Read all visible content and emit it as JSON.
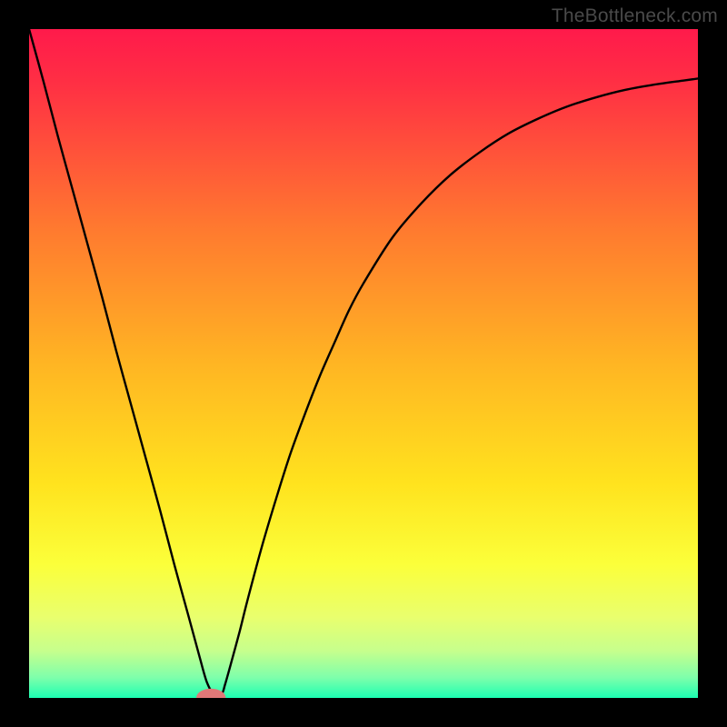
{
  "watermark": "TheBottleneck.com",
  "chart_data": {
    "type": "line",
    "title": "",
    "xlabel": "",
    "ylabel": "",
    "xlim": [
      0,
      100
    ],
    "ylim": [
      0,
      100
    ],
    "gradient_stops": [
      {
        "offset": 0.0,
        "color": "#ff1a4b"
      },
      {
        "offset": 0.08,
        "color": "#ff2f44"
      },
      {
        "offset": 0.3,
        "color": "#ff7a2f"
      },
      {
        "offset": 0.5,
        "color": "#ffb523"
      },
      {
        "offset": 0.68,
        "color": "#ffe31e"
      },
      {
        "offset": 0.8,
        "color": "#fbff3a"
      },
      {
        "offset": 0.88,
        "color": "#e9ff6e"
      },
      {
        "offset": 0.93,
        "color": "#c6ff8d"
      },
      {
        "offset": 0.97,
        "color": "#7dffab"
      },
      {
        "offset": 1.0,
        "color": "#1cffb2"
      }
    ],
    "series": [
      {
        "name": "curve",
        "x": [
          0.0,
          2.2,
          4.3,
          6.5,
          8.7,
          10.9,
          13.0,
          15.2,
          17.4,
          19.6,
          21.7,
          23.9,
          25.5,
          26.6,
          27.7,
          28.8,
          29.3,
          30.2,
          31.5,
          32.6,
          34.8,
          37.0,
          39.1,
          41.3,
          43.5,
          45.7,
          47.8,
          50.0,
          54.3,
          58.7,
          63.0,
          67.4,
          71.7,
          76.1,
          80.4,
          84.8,
          89.1,
          93.5,
          97.8,
          100.0
        ],
        "y": [
          100.0,
          92.0,
          84.0,
          76.0,
          68.0,
          60.0,
          52.0,
          44.0,
          36.0,
          28.0,
          20.0,
          12.0,
          6.1,
          2.3,
          0.5,
          0.6,
          2.0,
          5.2,
          10.0,
          14.4,
          22.6,
          30.0,
          36.6,
          42.6,
          48.2,
          53.2,
          57.9,
          62.0,
          68.8,
          74.0,
          78.2,
          81.6,
          84.4,
          86.6,
          88.4,
          89.8,
          90.9,
          91.7,
          92.3,
          92.6
        ]
      }
    ],
    "marker": {
      "x": 27.2,
      "y": 0.0,
      "rx": 2.2,
      "ry": 1.4,
      "color": "#e07878"
    }
  }
}
